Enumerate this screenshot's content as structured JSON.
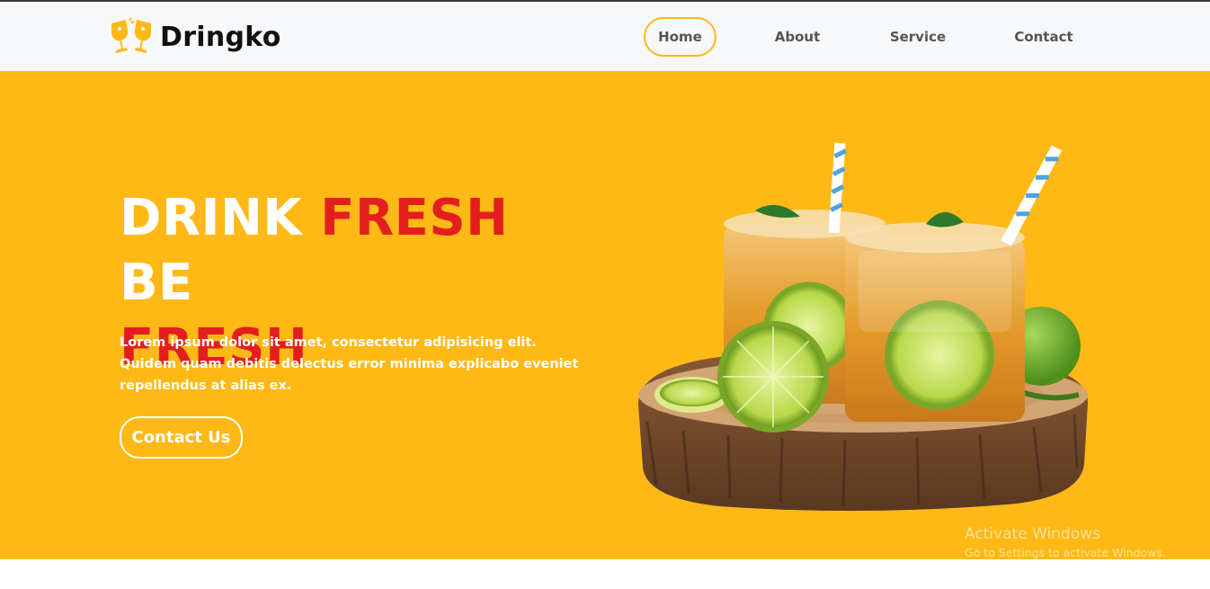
{
  "brand": {
    "name": "Dringko",
    "logo_icon": "cheers-glasses-icon",
    "accent_color": "#ffb917"
  },
  "nav": {
    "items": [
      {
        "label": "Home",
        "active": true
      },
      {
        "label": "About",
        "active": false
      },
      {
        "label": "Service",
        "active": false
      },
      {
        "label": "Contact",
        "active": false
      }
    ]
  },
  "hero": {
    "headline_word_1": "DRINK",
    "headline_word_2": "FRESH",
    "headline_word_3": "BE",
    "headline_word_4": "FRESH",
    "description": "Lorem ipsum dolor sit amet, consectetur adipisicing elit. Quidem quam debitis delectus error minima explicabo eveniet repellendus at alias ex.",
    "cta_label": "Contact Us",
    "background_color": "#ffb917",
    "highlight_color": "#e31e1e",
    "image": "lemon-iced-tea-drinks-on-wood-slice"
  },
  "watermark": {
    "title": "Activate Windows",
    "subtitle": "Go to Settings to activate Windows."
  }
}
